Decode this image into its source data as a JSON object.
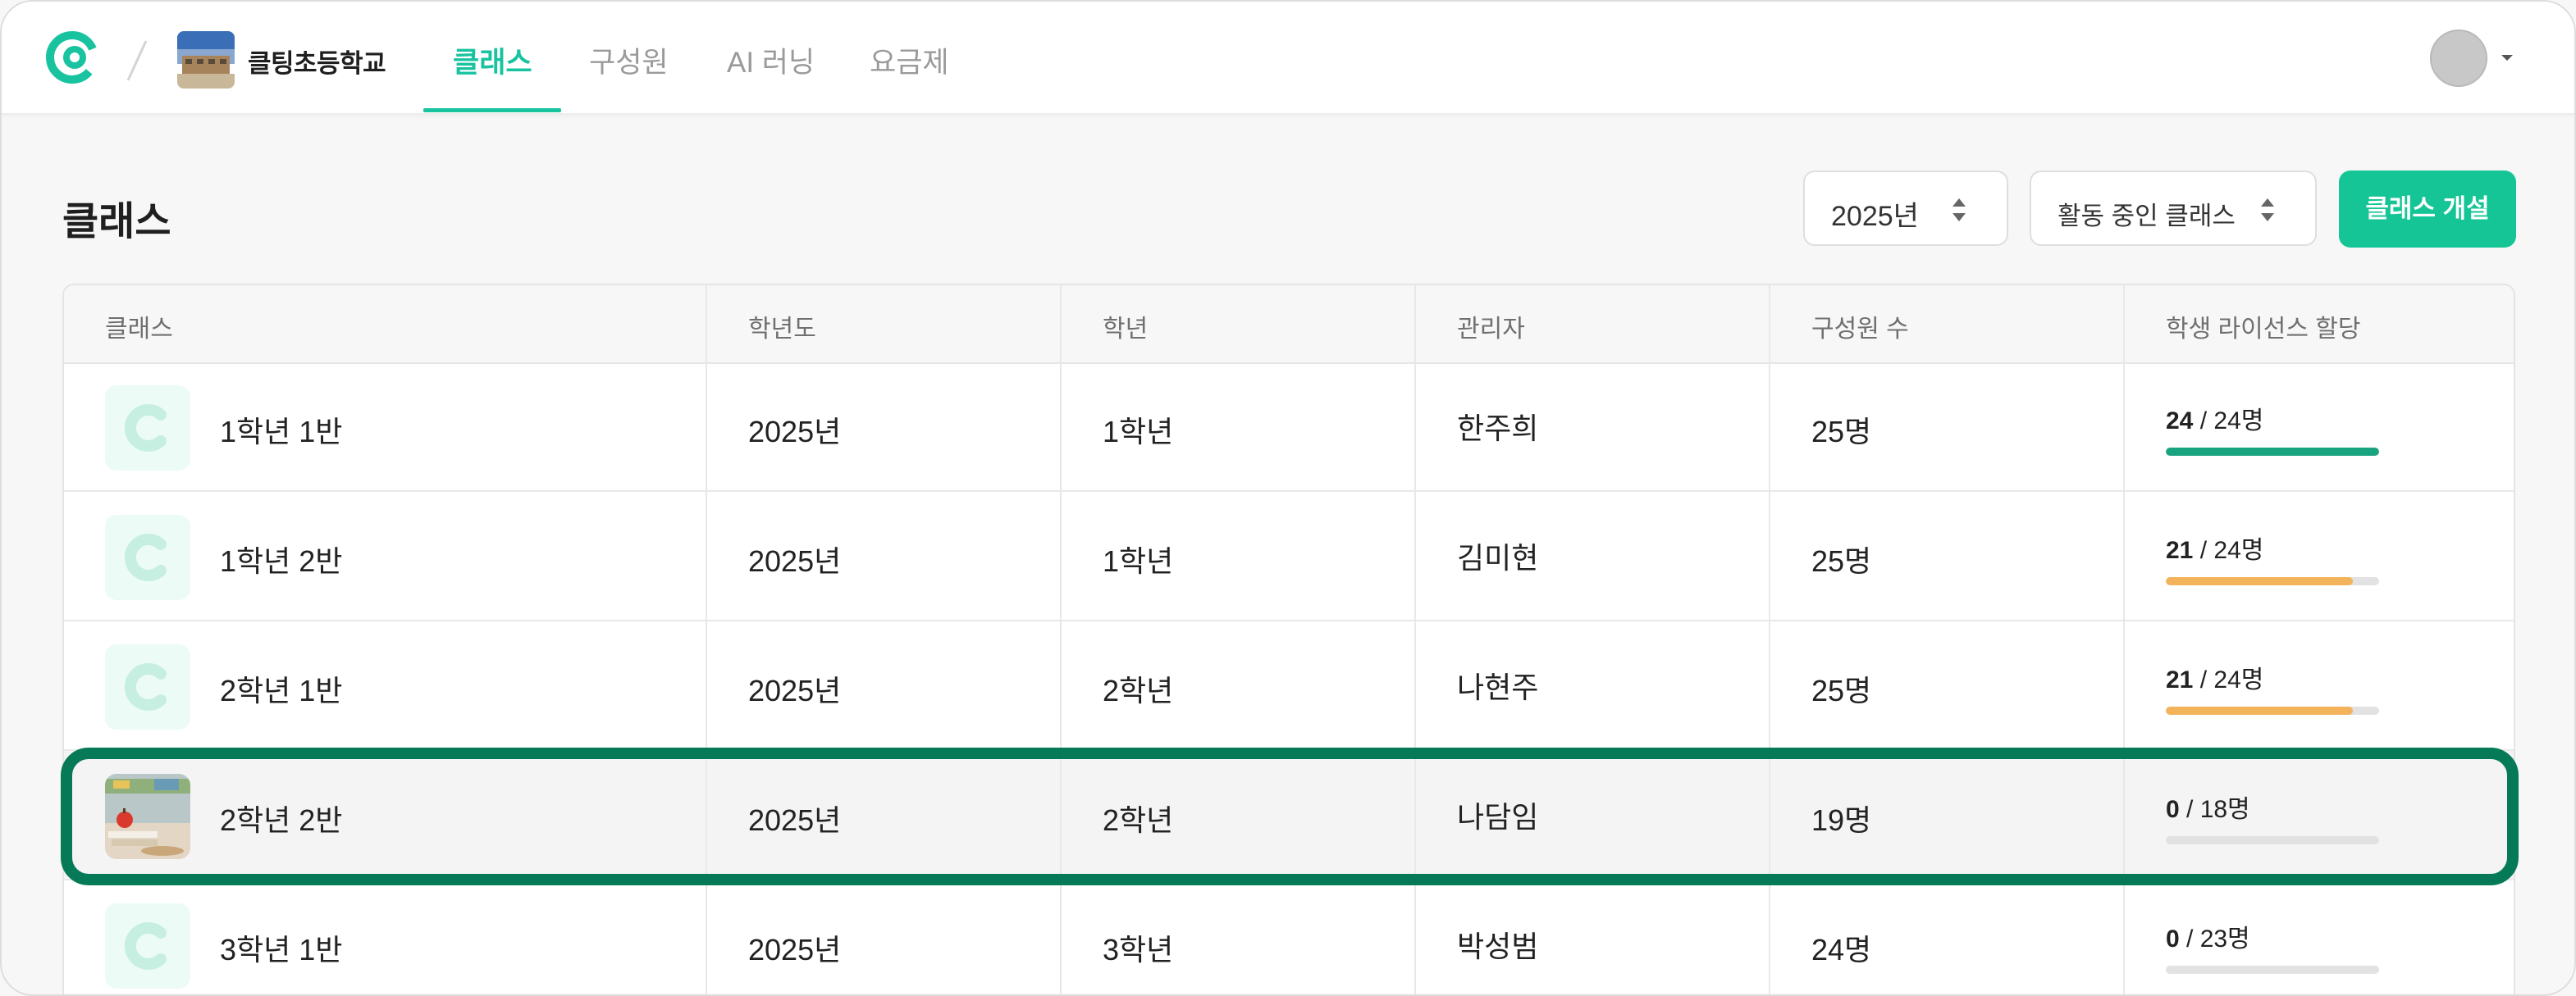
{
  "nav": {
    "school_name": "클팅초등학교",
    "tabs": [
      {
        "label": "클래스",
        "active": true
      },
      {
        "label": "구성원",
        "active": false
      },
      {
        "label": "AI 러닝",
        "active": false
      },
      {
        "label": "요금제",
        "active": false
      }
    ],
    "accent_color": "#19c3a0"
  },
  "page": {
    "title": "클래스",
    "year_select": "2025년",
    "status_select": "활동 중인 클래스",
    "create_button": "클래스 개설"
  },
  "table": {
    "headers": [
      "클래스",
      "학년도",
      "학년",
      "관리자",
      "구성원 수",
      "학생 라이선스 할당"
    ],
    "rows": [
      {
        "name": "1학년 1반",
        "year": "2025년",
        "grade": "1학년",
        "manager": "한주희",
        "members": "25명",
        "lic_used": "24",
        "lic_total": " / 24명",
        "ratio": 1.0,
        "bar_color": "#19a37f",
        "icon": "class-c-icon"
      },
      {
        "name": "1학년 2반",
        "year": "2025년",
        "grade": "1학년",
        "manager": "김미현",
        "members": "25명",
        "lic_used": "21",
        "lic_total": " / 24명",
        "ratio": 0.875,
        "bar_color": "#f2b35a",
        "icon": "class-c-icon"
      },
      {
        "name": "2학년 1반",
        "year": "2025년",
        "grade": "2학년",
        "manager": "나현주",
        "members": "25명",
        "lic_used": "21",
        "lic_total": " / 24명",
        "ratio": 0.875,
        "bar_color": "#f2b35a",
        "icon": "class-c-icon"
      },
      {
        "name": "2학년 2반",
        "year": "2025년",
        "grade": "2학년",
        "manager": "나담임",
        "members": "19명",
        "lic_used": "0",
        "lic_total": " / 18명",
        "ratio": 0,
        "bar_color": "#e2e2e2",
        "icon": "classroom-photo"
      },
      {
        "name": "3학년 1반",
        "year": "2025년",
        "grade": "3학년",
        "manager": "박성범",
        "members": "24명",
        "lic_used": "0",
        "lic_total": " / 23명",
        "ratio": 0,
        "bar_color": "#e2e2e2",
        "icon": "class-c-icon"
      }
    ]
  }
}
